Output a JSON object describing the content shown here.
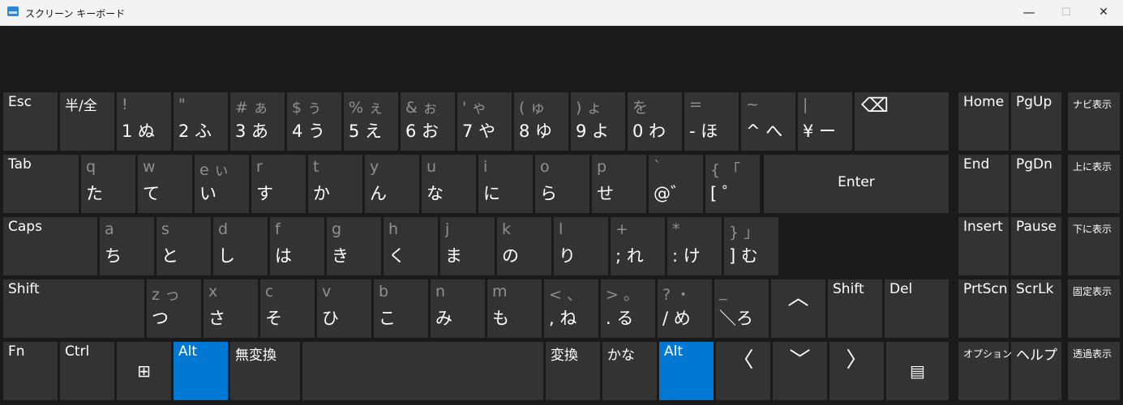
{
  "window": {
    "title": "スクリーン キーボード",
    "minimize_icon": "—",
    "maximize_icon": "☐",
    "close_icon": "✕"
  },
  "keyboard": {
    "accent_color": "#0078d4",
    "key_color": "#333333",
    "rows": [
      [
        {
          "name": "esc",
          "label": "Esc"
        },
        {
          "name": "hankaku",
          "label": "半/全"
        },
        {
          "name": "1",
          "sec": "!",
          "main": "1 ぬ"
        },
        {
          "name": "2",
          "sec": "\"",
          "main": "2 ふ"
        },
        {
          "name": "3",
          "sec": "# ぁ",
          "main": "3 あ"
        },
        {
          "name": "4",
          "sec": "$ ぅ",
          "main": "4 う"
        },
        {
          "name": "5",
          "sec": "% ぇ",
          "main": "5 え"
        },
        {
          "name": "6",
          "sec": "& ぉ",
          "main": "6 お"
        },
        {
          "name": "7",
          "sec": "'  ゃ",
          "main": "7 や"
        },
        {
          "name": "8",
          "sec": "(  ゅ",
          "main": "8 ゆ"
        },
        {
          "name": "9",
          "sec": ")  ょ",
          "main": "9 よ"
        },
        {
          "name": "0",
          "sec": "    を",
          "main": "0 わ"
        },
        {
          "name": "minus",
          "sec": "=",
          "main": "- ほ"
        },
        {
          "name": "caret",
          "sec": "~",
          "main": "^ へ"
        },
        {
          "name": "yen",
          "sec": "|",
          "main": "¥ ー"
        },
        {
          "name": "backspace",
          "icon": "⌫"
        },
        {
          "name": "home",
          "label": "Home"
        },
        {
          "name": "pgup",
          "label": "PgUp"
        },
        {
          "name": "navi",
          "label": "ナビ表示"
        }
      ],
      [
        {
          "name": "tab",
          "label": "Tab"
        },
        {
          "name": "q",
          "sec": "q",
          "main": "た"
        },
        {
          "name": "w",
          "sec": "w",
          "main": "て"
        },
        {
          "name": "e",
          "sec": "e ぃ",
          "main": "い"
        },
        {
          "name": "r",
          "sec": "r",
          "main": "す"
        },
        {
          "name": "t",
          "sec": "t",
          "main": "か"
        },
        {
          "name": "y",
          "sec": "y",
          "main": "ん"
        },
        {
          "name": "u",
          "sec": "u",
          "main": "な"
        },
        {
          "name": "i",
          "sec": "i",
          "main": "に"
        },
        {
          "name": "o",
          "sec": "o",
          "main": "ら"
        },
        {
          "name": "p",
          "sec": "p",
          "main": "せ"
        },
        {
          "name": "at",
          "sec": "`",
          "main": "@゛"
        },
        {
          "name": "bracket-open",
          "sec": "{ 「",
          "main": "[  ゜"
        },
        {
          "name": "enter",
          "label": "Enter"
        },
        {
          "name": "end",
          "label": "End"
        },
        {
          "name": "pgdn",
          "label": "PgDn"
        },
        {
          "name": "up-display",
          "label": "上に表示"
        }
      ],
      [
        {
          "name": "caps",
          "label": "Caps"
        },
        {
          "name": "a",
          "sec": "a",
          "main": "ち"
        },
        {
          "name": "s",
          "sec": "s",
          "main": "と"
        },
        {
          "name": "d",
          "sec": "d",
          "main": "し"
        },
        {
          "name": "f",
          "sec": "f",
          "main": "は"
        },
        {
          "name": "g",
          "sec": "g",
          "main": "き"
        },
        {
          "name": "h",
          "sec": "h",
          "main": "く"
        },
        {
          "name": "j",
          "sec": "j",
          "main": "ま"
        },
        {
          "name": "k",
          "sec": "k",
          "main": "の"
        },
        {
          "name": "l",
          "sec": "l",
          "main": "り"
        },
        {
          "name": "semicolon",
          "sec": "+",
          "main": "; れ"
        },
        {
          "name": "colon",
          "sec": "*",
          "main": ": け"
        },
        {
          "name": "bracket-close",
          "sec": "}  」",
          "main": "] む"
        },
        {
          "name": "insert",
          "label": "Insert"
        },
        {
          "name": "pause",
          "label": "Pause"
        },
        {
          "name": "down-display",
          "label": "下に表示"
        }
      ],
      [
        {
          "name": "shift-left",
          "label": "Shift"
        },
        {
          "name": "z",
          "sec": "z っ",
          "main": "つ"
        },
        {
          "name": "x",
          "sec": "x",
          "main": "さ"
        },
        {
          "name": "c",
          "sec": "c",
          "main": "そ"
        },
        {
          "name": "v",
          "sec": "v",
          "main": "ひ"
        },
        {
          "name": "b",
          "sec": "b",
          "main": "こ"
        },
        {
          "name": "n",
          "sec": "n",
          "main": "み"
        },
        {
          "name": "m",
          "sec": "m",
          "main": "も"
        },
        {
          "name": "comma",
          "sec": "<  、",
          "main": ", ね"
        },
        {
          "name": "period",
          "sec": ">  。",
          "main": ". る"
        },
        {
          "name": "slash",
          "sec": "?  ・",
          "main": "/ め"
        },
        {
          "name": "backslash",
          "sec": "_",
          "main": "＼ろ"
        },
        {
          "name": "arrow-up",
          "icon": "︿"
        },
        {
          "name": "shift-right",
          "label": "Shift"
        },
        {
          "name": "del",
          "label": "Del"
        },
        {
          "name": "prtscn",
          "label": "PrtScn"
        },
        {
          "name": "scrlk",
          "label": "ScrLk"
        },
        {
          "name": "fixed-display",
          "label": "固定表示"
        }
      ],
      [
        {
          "name": "fn",
          "label": "Fn"
        },
        {
          "name": "ctrl",
          "label": "Ctrl"
        },
        {
          "name": "windows",
          "icon": "⊞"
        },
        {
          "name": "alt-left",
          "label": "Alt"
        },
        {
          "name": "muhenkan",
          "label": "無変換"
        },
        {
          "name": "space",
          "label": ""
        },
        {
          "name": "henkan",
          "label": "変換"
        },
        {
          "name": "kana",
          "label": "かな"
        },
        {
          "name": "alt-right",
          "label": "Alt"
        },
        {
          "name": "arrow-left",
          "icon": "〈"
        },
        {
          "name": "arrow-down",
          "icon": "﹀"
        },
        {
          "name": "arrow-right",
          "icon": "〉"
        },
        {
          "name": "menu",
          "icon": "▤"
        },
        {
          "name": "options",
          "label": "オプション"
        },
        {
          "name": "help",
          "label": "ヘルプ"
        },
        {
          "name": "transparency",
          "label": "透過表示"
        }
      ]
    ]
  }
}
